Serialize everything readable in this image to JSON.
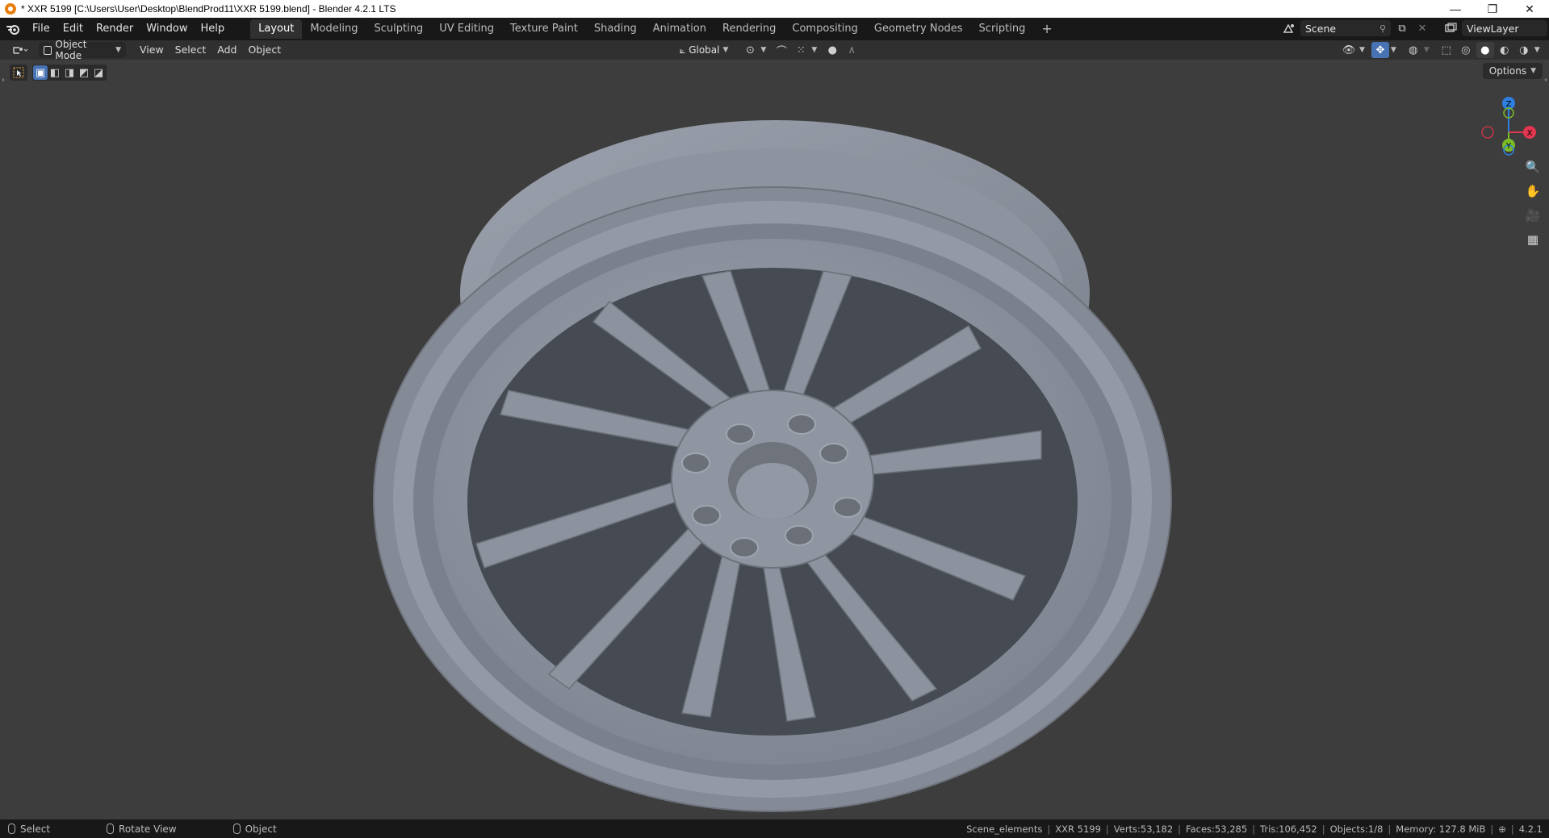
{
  "window": {
    "title": "* XXR 5199 [C:\\Users\\User\\Desktop\\BlendProd11\\XXR 5199.blend] - Blender 4.2.1 LTS",
    "controls": {
      "minimize": "—",
      "restore": "❐",
      "close": "✕"
    }
  },
  "menu": {
    "items": [
      "File",
      "Edit",
      "Render",
      "Window",
      "Help"
    ]
  },
  "workspaces": {
    "tabs": [
      "Layout",
      "Modeling",
      "Sculpting",
      "UV Editing",
      "Texture Paint",
      "Shading",
      "Animation",
      "Rendering",
      "Compositing",
      "Geometry Nodes",
      "Scripting"
    ],
    "active": "Layout",
    "add": "+"
  },
  "scene": {
    "name": "Scene",
    "view_layer": "ViewLayer"
  },
  "header": {
    "mode": "Object Mode",
    "menus": [
      "View",
      "Select",
      "Add",
      "Object"
    ],
    "orientation": "Global"
  },
  "viewport": {
    "options_label": "Options",
    "gizmo": {
      "z": "Z",
      "x": "X",
      "y": "Y"
    },
    "colors": {
      "background": "#3d3d3d",
      "model": "#8a909c",
      "x_axis": "#e1364f",
      "y_axis": "#7cbb28",
      "z_axis": "#2e7fe0"
    }
  },
  "status": {
    "left": [
      {
        "icon": "mouse-left-icon",
        "label": "Select"
      },
      {
        "icon": "mouse-middle-icon",
        "label": "Rotate View"
      },
      {
        "icon": "mouse-right-icon",
        "label": "Object"
      }
    ],
    "right": {
      "collection": "Scene_elements",
      "object": "XXR 5199",
      "verts": "Verts:53,182",
      "faces": "Faces:53,285",
      "tris": "Tris:106,452",
      "objects": "Objects:1/8",
      "memory": "Memory: 127.8 MiB",
      "version": "4.2.1"
    }
  }
}
